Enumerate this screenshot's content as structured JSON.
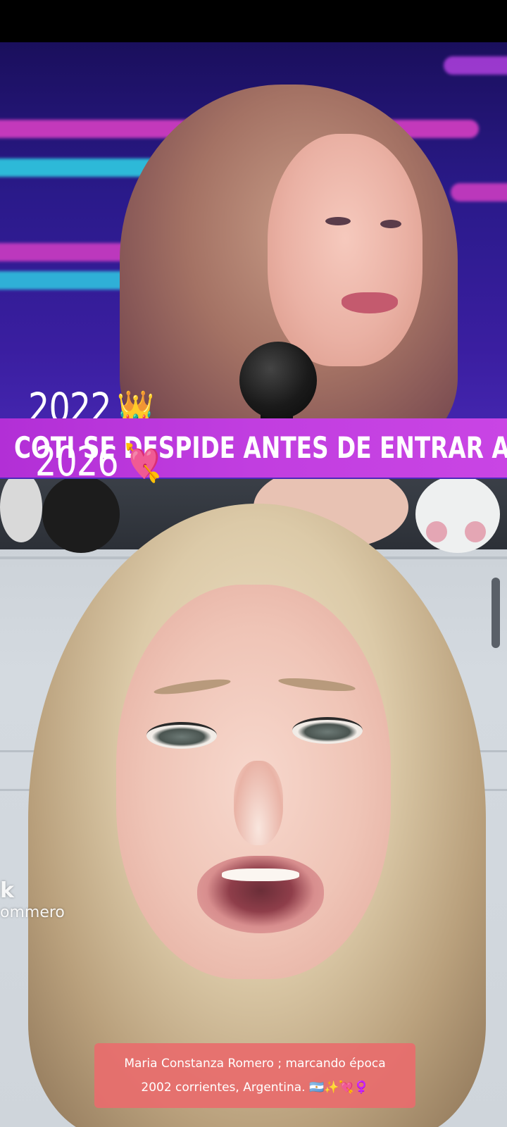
{
  "top_video": {
    "year": "2022",
    "year_emoji": "👑",
    "ticker": "COTI SE DESPIDE ANTES DE ENTRAR A LA"
  },
  "bottom_video": {
    "year": "2026",
    "year_emoji": "💘",
    "watermark_logo": "k",
    "watermark_handle": "ommero"
  },
  "caption": {
    "line1": "Maria Constanza Romero ; marcando época",
    "line2": "2002 corrientes, Argentina. 🇦🇷✨💘♀️"
  },
  "colors": {
    "ticker_bg": "#c13ee0",
    "caption_bg": "#e86c6c",
    "stage_pink": "#e040c8",
    "stage_cyan": "#2fd6e8"
  }
}
